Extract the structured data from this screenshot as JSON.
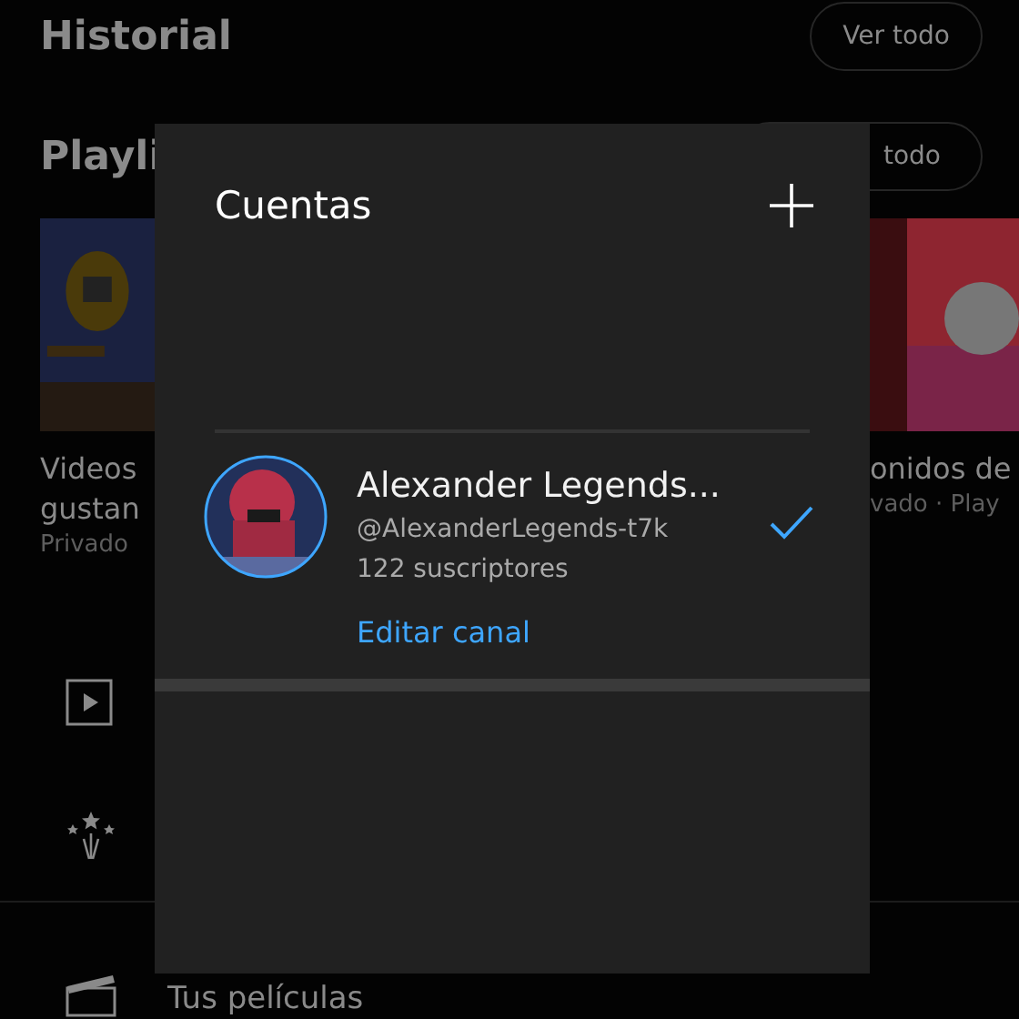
{
  "background": {
    "sections": [
      {
        "title": "Historial",
        "button": "Ver todo"
      },
      {
        "title": "Playli",
        "button": "todo"
      }
    ],
    "cards": [
      {
        "title_lines": [
          "Videos",
          "gustan"
        ],
        "subtitle": "Privado"
      },
      {
        "title_lines": [
          "onidos de"
        ],
        "subtitle": "vado · Play"
      }
    ],
    "menu": [
      {
        "kind": "play"
      },
      {
        "kind": "sparkle"
      },
      {
        "kind": "clapper",
        "label": "Tus películas"
      }
    ]
  },
  "dialog": {
    "title": "Cuentas",
    "accounts": [
      {
        "name": "Alexander Legends...",
        "handle": "@AlexanderLegends-t7k",
        "subscribers": "122 suscriptores",
        "selected": true,
        "action": "Editar canal"
      }
    ]
  }
}
